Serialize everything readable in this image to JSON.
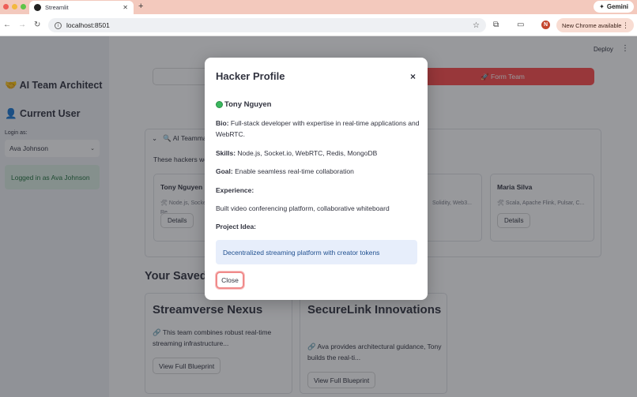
{
  "browser": {
    "tab_title": "Streamlit",
    "tab_close": "✕",
    "new_tab": "+",
    "gemini_label": "Gemini",
    "url": "localhost:8501",
    "profile_initial": "N",
    "chrome_update": "New Chrome available"
  },
  "app": {
    "deploy_label": "Deploy",
    "sidebar": {
      "title": "🤝 AI Team Architect",
      "current_user_heading": "👤 Current User",
      "login_label": "Login as:",
      "selected_user": "Ava Johnson",
      "success_message": "Logged in as Ava Johnson"
    },
    "main": {
      "form_team_button": "🚀 Form Team",
      "expander_title": "🔍 AI Teamma",
      "expander_desc": "These hackers we",
      "hacker_cards": [
        {
          "name": "Tony Nguyen",
          "skills_line1": "🛠 Node.js, Socke",
          "skills_line2": "Re...",
          "button": "Details"
        },
        {
          "name": "",
          "skills_line1": "Solidity, Web3...",
          "skills_line2": "",
          "button": ""
        },
        {
          "name": "Maria Silva",
          "skills_line1": "🛠 Scala, Apache Flink, Pulsar, C...",
          "skills_line2": "",
          "button": "Details"
        }
      ],
      "saved_title": "Your Saved",
      "saved_teams": [
        {
          "title": "Streamverse Nexus",
          "desc_line1": "🔗 This team combines robust real-time",
          "desc_line2": "streaming infrastructure...",
          "button": "View Full Blueprint"
        },
        {
          "title": "SecureLink Innovations",
          "desc_line1": "🔗 Ava provides architectural guidance, Tony",
          "desc_line2": "builds the real-ti...",
          "button": "View Full Blueprint"
        }
      ]
    }
  },
  "modal": {
    "title": "Hacker Profile",
    "close_x": "×",
    "name": "Tony Nguyen",
    "bio_label": "Bio:",
    "bio": "Full-stack developer with expertise in real-time applications and WebRTC.",
    "skills_label": "Skills:",
    "skills": "Node.js, Socket.io, WebRTC, Redis, MongoDB",
    "goal_label": "Goal:",
    "goal": "Enable seamless real-time collaboration",
    "experience_label": "Experience:",
    "experience": "Built video conferencing platform, collaborative whiteboard",
    "project_label": "Project Idea:",
    "project": "Decentralized streaming platform with creator tokens",
    "close_button": "Close"
  },
  "colors": {
    "primary": "#ff4b4b",
    "success_bg": "#dcefe3",
    "info_bg": "#e7eefb"
  }
}
